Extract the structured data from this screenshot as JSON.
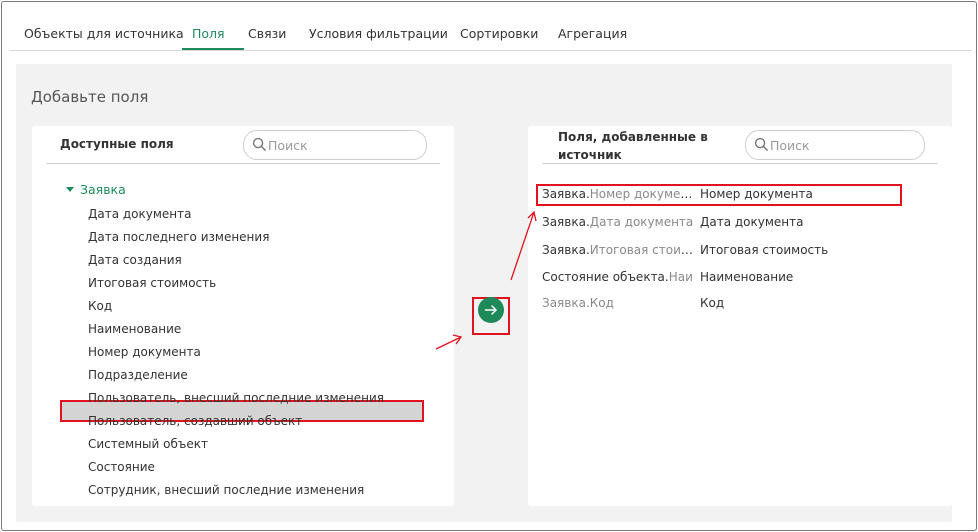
{
  "tabs": [
    {
      "label": "Объекты для источника",
      "active": false
    },
    {
      "label": "Поля",
      "active": true
    },
    {
      "label": "Связи",
      "active": false
    },
    {
      "label": "Условия фильтрации",
      "active": false
    },
    {
      "label": "Сортировки",
      "active": false
    },
    {
      "label": "Агрегация",
      "active": false
    }
  ],
  "panel_title": "Добавьте поля",
  "available": {
    "title": "Доступные поля",
    "search_placeholder": "Поиск",
    "group": "Заявка",
    "fields": [
      "Дата документа",
      "Дата последнего изменения",
      "Дата создания",
      "Итоговая стоимость",
      "Код",
      "Наименование",
      "Номер документа",
      "Подразделение",
      "Пользователь, внесший последние изменения",
      "Пользователь, создавший объект",
      "Системный объект",
      "Состояние",
      "Сотрудник, внесший последние изменения"
    ],
    "selected_index": 6
  },
  "added": {
    "title_line1": "Поля, добавленные в",
    "title_line2": "источник",
    "search_placeholder": "Поиск",
    "rows": [
      {
        "source_object": "Заявка.",
        "source_field": "Номер документа",
        "name": "Номер документа",
        "object_dark": true
      },
      {
        "source_object": "Заявка.",
        "source_field": "Дата документа",
        "name": "Дата документа",
        "object_dark": true
      },
      {
        "source_object": "Заявка.",
        "source_field": "Итоговая стоимо...",
        "name": "Итоговая стоимость",
        "object_dark": true
      },
      {
        "source_object": "Состояние объекта.",
        "source_field": "Наи",
        "name": "Наименование",
        "object_dark": true
      },
      {
        "source_object": "Заявка.",
        "source_field": "Код",
        "name": "Код",
        "object_dark": false
      }
    ]
  },
  "colors": {
    "accent": "#1f8a5b",
    "annotation": "#e0141e",
    "panel": "#f2f2f2"
  },
  "icons": {
    "search": "search-icon",
    "move": "arrow-right-icon",
    "group_toggle": "caret-down-icon"
  }
}
